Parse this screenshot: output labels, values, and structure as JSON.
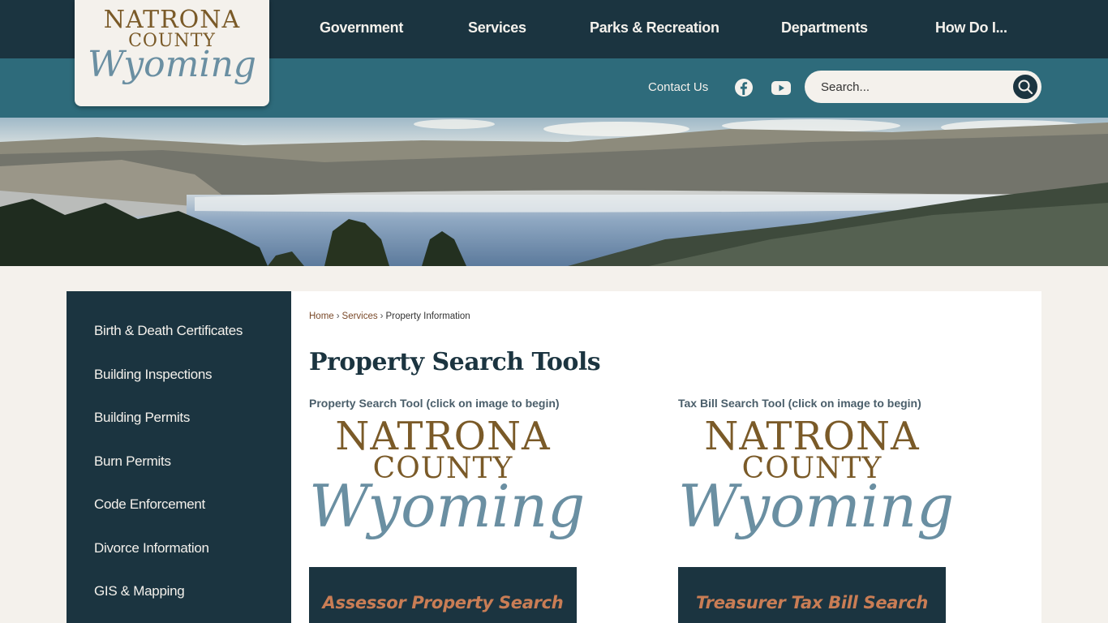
{
  "header": {
    "logo": {
      "line1": "NATRONA",
      "line2": "COUNTY",
      "line3": "Wyoming"
    },
    "nav": [
      {
        "label": "Government"
      },
      {
        "label": "Services"
      },
      {
        "label": "Parks & Recreation"
      },
      {
        "label": "Departments"
      },
      {
        "label": "How Do I..."
      }
    ],
    "contact_label": "Contact Us",
    "social": [
      {
        "icon": "facebook-icon"
      },
      {
        "icon": "youtube-icon"
      }
    ],
    "search": {
      "placeholder": "Search...",
      "value": "",
      "icon": "search-icon"
    }
  },
  "hero": {
    "alt": "Snowy canyon landscape with misty lake"
  },
  "sidebar": {
    "items": [
      {
        "label": "Birth & Death Certificates"
      },
      {
        "label": "Building Inspections"
      },
      {
        "label": "Building Permits"
      },
      {
        "label": "Burn Permits"
      },
      {
        "label": "Code Enforcement"
      },
      {
        "label": "Divorce Information"
      },
      {
        "label": "GIS & Mapping"
      }
    ]
  },
  "main": {
    "breadcrumb": [
      {
        "label": "Home",
        "link": true
      },
      {
        "label": "Services",
        "link": true
      },
      {
        "label": "Property Information",
        "link": false
      }
    ],
    "breadcrumb_separator": "›",
    "title": "Property Search Tools",
    "tools": [
      {
        "label": "Property Search Tool (click on image to begin)",
        "logo": {
          "line1": "NATRONA",
          "line2": "COUNTY",
          "line3": "Wyoming"
        },
        "button_label": "Assessor Property Search"
      },
      {
        "label": "Tax Bill Search Tool (click on image to begin)",
        "logo": {
          "line1": "NATRONA",
          "line2": "COUNTY",
          "line3": "Wyoming"
        },
        "button_label": "Treasurer Tax Bill Search"
      }
    ]
  },
  "colors": {
    "dark_teal": "#1b3440",
    "mid_teal": "#2e6b7b",
    "cream": "#f4f1ec",
    "gold": "#7a5a28",
    "script_blue": "#6a8fa2",
    "button_text": "#c97d55"
  }
}
